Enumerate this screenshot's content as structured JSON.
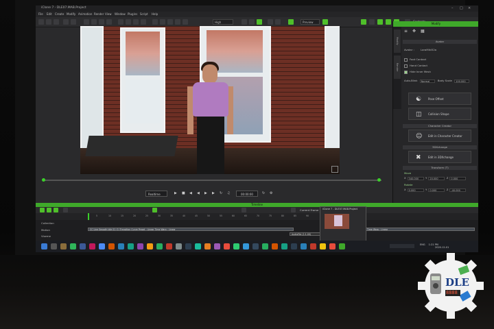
{
  "window": {
    "title": "iClone 7 - DLE07.MAB.Project"
  },
  "menu": [
    "File",
    "Edit",
    "Create",
    "Modify",
    "Animation",
    "Render",
    "View",
    "Window",
    "Plugins",
    "Script",
    "Help"
  ],
  "toolbar": {
    "quality_select": "High",
    "preview_select": "Preview",
    "contents_label": "Contents"
  },
  "viewport": {
    "playback_mode": "Realtime",
    "timecode": "00:00:00"
  },
  "panel": {
    "title": "Modify",
    "side_tabs": [
      "Modify",
      "Render"
    ],
    "avatar_header": "Avatar",
    "avatar_name_label": "Avatar :",
    "avatar_name": "LaraMiki52a",
    "checks": [
      {
        "label": "Foot Contact",
        "checked": false
      },
      {
        "label": "Hand Contact",
        "checked": false
      },
      {
        "label": "Hide Inner Mesh",
        "checked": true
      }
    ],
    "autoblink_label": "Auto-Blink",
    "autoblink_value": "Normal",
    "body_scale_label": "Body Scale",
    "body_scale_value": "100.000",
    "pose_offset_button": "Pose Offset",
    "collision_button": "Collision Shape",
    "character_creator_header": "Character Creator",
    "edit_cc_button": "Edit in Character Creator",
    "threedx_header": "3DXchange",
    "edit_3dx_button": "Edit in 3DXchange",
    "transform_header": "Transform (T)",
    "move_label": "Move",
    "move": {
      "x": "340.000",
      "y": "20.000",
      "z": "0.000"
    },
    "rotate_label": "Rotate",
    "rotate": {
      "x": "0.000",
      "y": "0.000",
      "z": "-40.000"
    }
  },
  "timeline": {
    "title": "Timeline",
    "current_frame_label": "Current Frame",
    "current_frame": "1",
    "ruler": [
      "5",
      "10",
      "15",
      "20",
      "25",
      "30",
      "35",
      "40",
      "45",
      "50",
      "55",
      "60",
      "65",
      "70",
      "75",
      "80",
      "85",
      "90",
      "95",
      "100"
    ],
    "tracks": [
      "Collection",
      "Motion",
      "Viseme"
    ],
    "clip_label": "CC Line Smooth Idle 01 (1) Transition Curve Preset : Linear Time Warp : Linear",
    "right_clip_label": "Time Warp : Linear",
    "audio_chip": "AudioFile (1:1.00)"
  },
  "popup": {
    "title": "iClone 7 - DLE07.MAB.Project"
  },
  "taskbar": {
    "lang": "ENG",
    "time": "1:21 PM",
    "date": "2020-12-01"
  },
  "logo": {
    "text": "DLE",
    "display": "8888"
  },
  "colors": {
    "accent": "#3fa92a",
    "panel_bg": "#262628",
    "viewport_brick": "#7a3a2c",
    "shirt": "#b07bc0"
  }
}
